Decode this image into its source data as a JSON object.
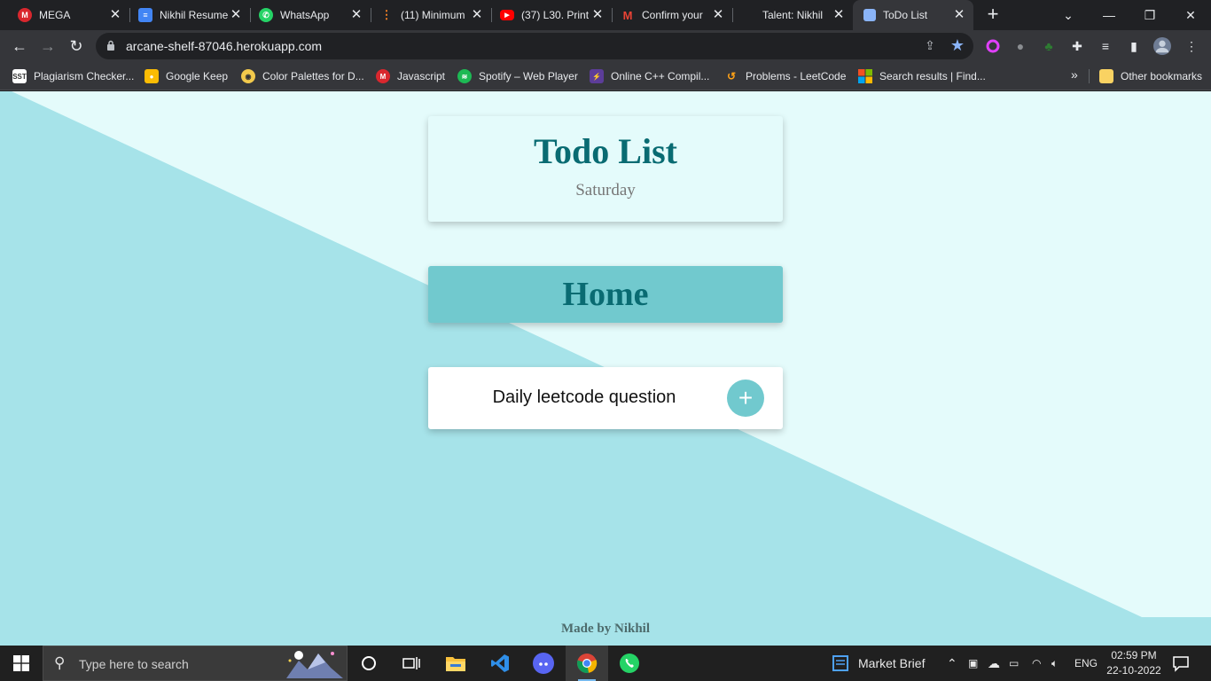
{
  "browser": {
    "tabs": [
      {
        "title": "MEGA",
        "favicon": "mega-icon",
        "color": "#d9272e"
      },
      {
        "title": "Nikhil Resume",
        "favicon": "google-docs-icon",
        "color": "#4285f4"
      },
      {
        "title": "WhatsApp",
        "favicon": "whatsapp-icon",
        "color": "#25d366"
      },
      {
        "title": "(11) Minimum",
        "favicon": "stackoverflow-icon",
        "color": "#f48024"
      },
      {
        "title": "(37) L30. Print",
        "favicon": "youtube-icon",
        "color": "#ff0000"
      },
      {
        "title": "Confirm your",
        "favicon": "gmail-icon",
        "color": "#ea4335"
      },
      {
        "title": "Talent: Nikhil",
        "favicon": "blank-icon",
        "color": "#202124"
      },
      {
        "title": "ToDo List",
        "favicon": "page-icon",
        "color": "#8ab4f8",
        "active": true
      }
    ],
    "url": "arcane-shelf-87046.herokuapp.com",
    "bookmarks": [
      {
        "label": "Plagiarism Checker...",
        "icon": "sst-icon",
        "color": "#ffffff"
      },
      {
        "label": "Google Keep",
        "icon": "keep-icon",
        "color": "#fbbc04"
      },
      {
        "label": "Color Palettes for D...",
        "icon": "palette-icon",
        "color": "#f2c94c"
      },
      {
        "label": "Javascript",
        "icon": "mega-icon",
        "color": "#d9272e"
      },
      {
        "label": "Spotify – Web Player",
        "icon": "spotify-icon",
        "color": "#1db954"
      },
      {
        "label": "Online C++ Compil...",
        "icon": "bolt-icon",
        "color": "#5c3d99"
      },
      {
        "label": "Problems - LeetCode",
        "icon": "leetcode-icon",
        "color": "#ffa116"
      },
      {
        "label": "Search results | Find...",
        "icon": "microsoft-icon",
        "color": "#f25022"
      }
    ],
    "other_bookmarks": "Other bookmarks"
  },
  "page": {
    "title": "Todo List",
    "day": "Saturday",
    "list_name": "Home",
    "new_item_value": "Daily leetcode question",
    "add_label": "+",
    "footer": "Made by Nikhil",
    "colors": {
      "background": "#e4fbfb",
      "diagonal": "#a6e3e9",
      "accent": "#71c9ce",
      "heading": "#096b72"
    }
  },
  "taskbar": {
    "search_placeholder": "Type here to search",
    "news_label": "Market Brief",
    "language": "ENG",
    "time": "02:59 PM",
    "date": "22-10-2022"
  }
}
